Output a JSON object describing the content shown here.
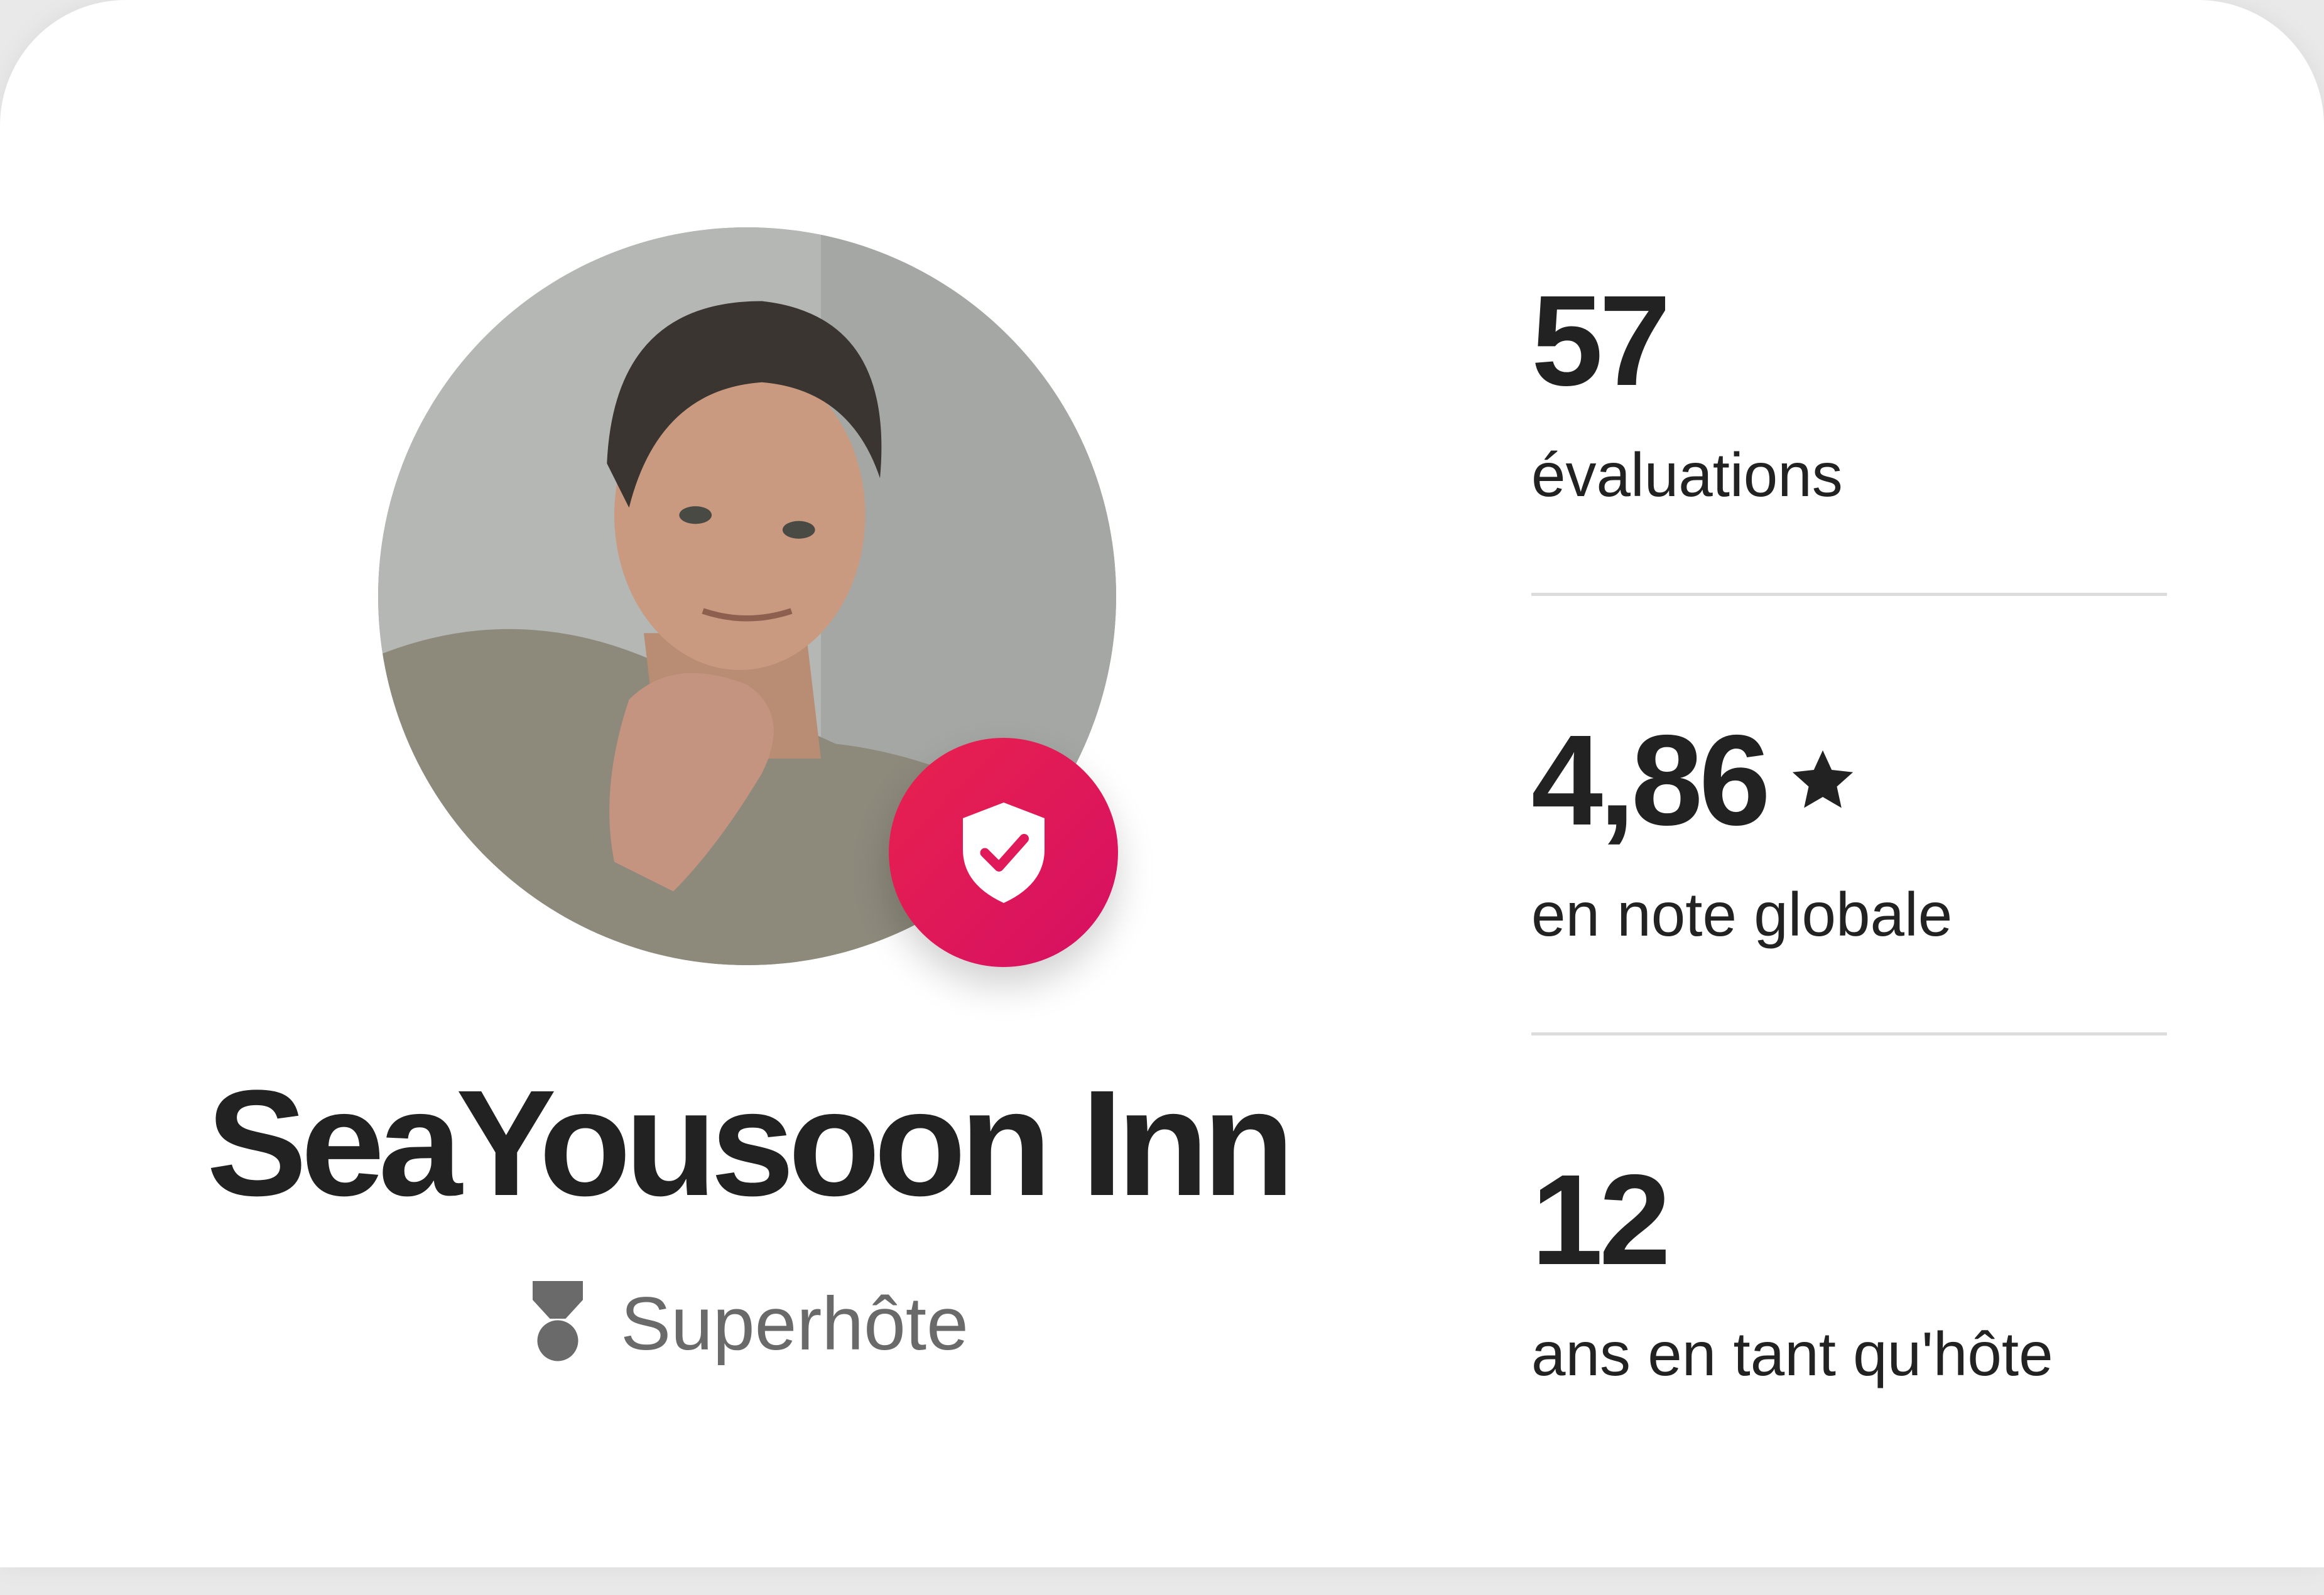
{
  "host": {
    "name": "SeaYousoon Inn",
    "badge_label": "Superhôte",
    "badge_icon": "superhost-medal-icon",
    "verified_icon": "shield-check-icon"
  },
  "stats": [
    {
      "value": "57",
      "label": "évaluations",
      "icon": ""
    },
    {
      "value": "4,86",
      "label": "en note globale",
      "icon": "star-icon"
    },
    {
      "value": "12",
      "label": "ans en tant qu'hôte",
      "icon": ""
    }
  ],
  "colors": {
    "accent_start": "#e8224d",
    "accent_end": "#d60f63",
    "text_primary": "#222222",
    "text_secondary": "#6a6a6a",
    "divider": "#dcdcdc"
  }
}
